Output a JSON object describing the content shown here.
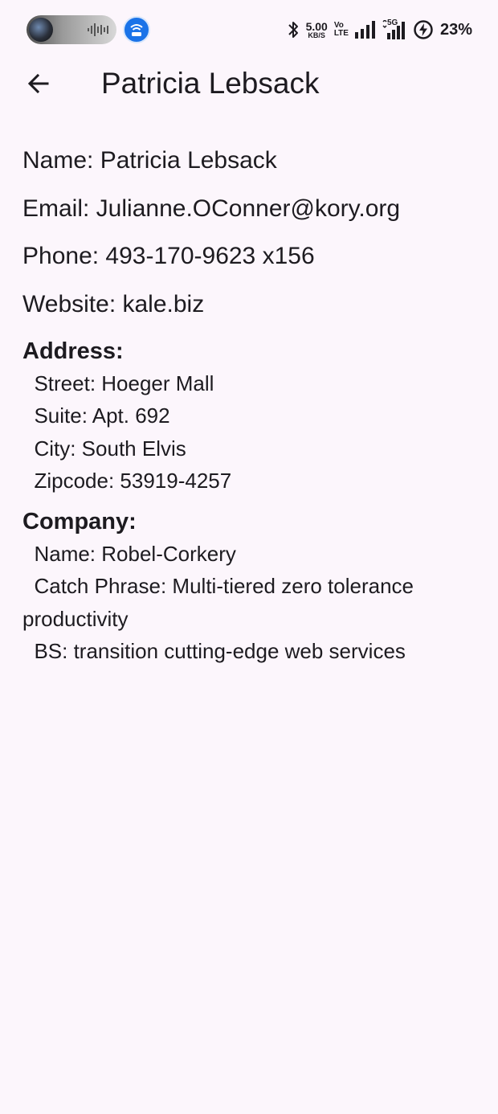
{
  "status_bar": {
    "net_speed_value": "5.00",
    "net_speed_unit": "KB/S",
    "volte_top": "Vo",
    "volte_bottom": "LTE",
    "network_label": "5G",
    "battery_percent": "23%",
    "icons": [
      "media-player-icon",
      "hotspot-icon",
      "bluetooth-icon",
      "signal-icon",
      "signal-5g-icon",
      "battery-charging-icon"
    ]
  },
  "app_bar": {
    "back_icon": "arrow-left-icon",
    "title": "Patricia Lebsack"
  },
  "details": {
    "name": "Name: Patricia Lebsack",
    "email": "Email: Julianne.OConner@kory.org",
    "phone": "Phone: 493-170-9623 x156",
    "website": "Website: kale.biz"
  },
  "address": {
    "heading": "Address:",
    "street": "Street: Hoeger Mall",
    "suite": "Suite: Apt. 692",
    "city": "City: South Elvis",
    "zipcode": "Zipcode: 53919-4257"
  },
  "company": {
    "heading": "Company:",
    "name": "Name: Robel-Corkery",
    "catch_phrase": "Catch Phrase: Multi-tiered zero tolerance productivity",
    "bs": "BS: transition cutting-edge web services"
  },
  "colors": {
    "background": "#fcf6fc",
    "text": "#1d1b20",
    "hotspot_blue": "#1a73e8"
  }
}
